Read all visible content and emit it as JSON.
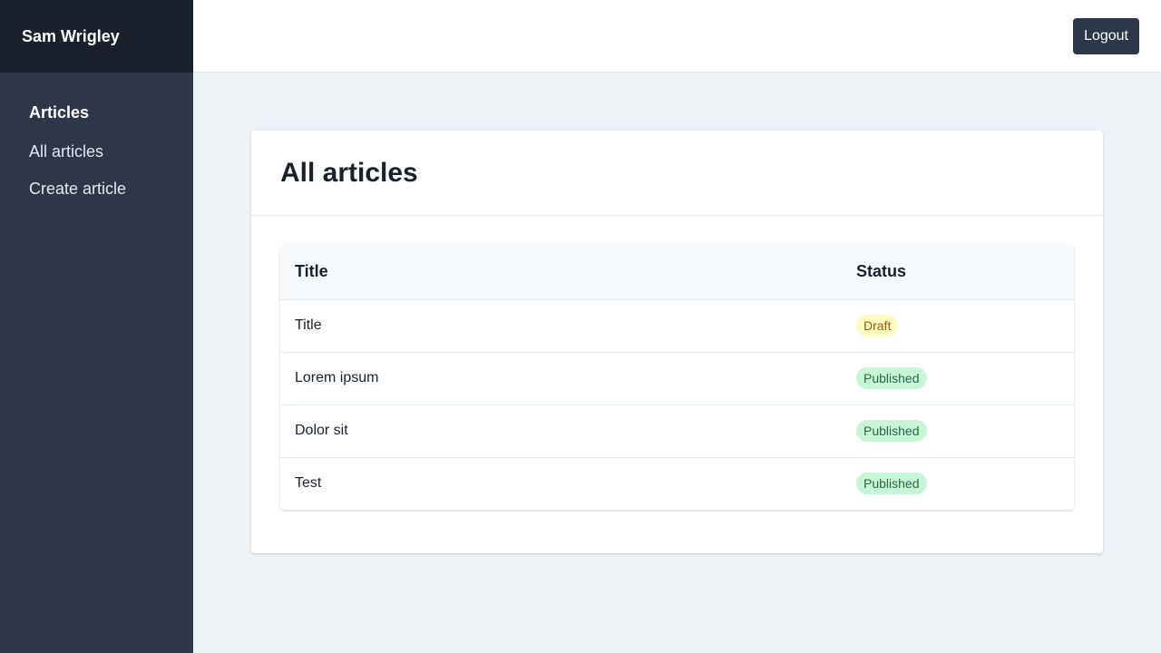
{
  "brand": {
    "name": "Sam Wrigley"
  },
  "sidebar": {
    "heading": "Articles",
    "items": [
      {
        "label": "All articles"
      },
      {
        "label": "Create article"
      }
    ]
  },
  "topbar": {
    "logout_label": "Logout"
  },
  "main": {
    "title": "All articles",
    "table": {
      "headers": {
        "title": "Title",
        "status": "Status"
      },
      "rows": [
        {
          "title": "Title",
          "status": "Draft",
          "status_kind": "draft"
        },
        {
          "title": "Lorem ipsum",
          "status": "Published",
          "status_kind": "published"
        },
        {
          "title": "Dolor sit",
          "status": "Published",
          "status_kind": "published"
        },
        {
          "title": "Test",
          "status": "Published",
          "status_kind": "published"
        }
      ]
    }
  },
  "colors": {
    "sidebar_bg": "#2d3748",
    "brand_bg": "#1a202c",
    "draft_bg": "#fefcbf",
    "draft_text": "#975a16",
    "published_bg": "#c6f6d5",
    "published_text": "#276749"
  }
}
